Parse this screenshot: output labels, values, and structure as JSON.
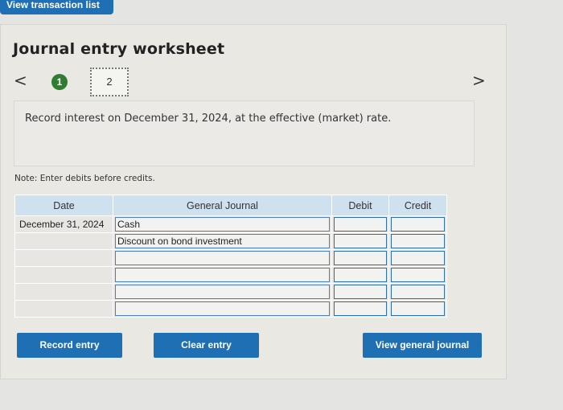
{
  "header": {
    "view_transactions_label": "View transaction list"
  },
  "worksheet": {
    "title": "Journal entry worksheet",
    "nav": {
      "prev_glyph": "<",
      "next_glyph": ">"
    },
    "steps": [
      "1",
      "2"
    ],
    "prompt": "Record interest on December 31, 2024, at the effective (market) rate.",
    "note": "Note: Enter debits before credits."
  },
  "table": {
    "headers": {
      "date": "Date",
      "general_journal": "General Journal",
      "debit": "Debit",
      "credit": "Credit"
    },
    "rows": [
      {
        "date": "December 31, 2024",
        "account": "Cash",
        "debit": "",
        "credit": ""
      },
      {
        "date": "",
        "account": "Discount on bond investment",
        "debit": "",
        "credit": ""
      },
      {
        "date": "",
        "account": "",
        "debit": "",
        "credit": ""
      },
      {
        "date": "",
        "account": "",
        "debit": "",
        "credit": ""
      },
      {
        "date": "",
        "account": "",
        "debit": "",
        "credit": ""
      },
      {
        "date": "",
        "account": "",
        "debit": "",
        "credit": ""
      }
    ]
  },
  "buttons": {
    "record": "Record entry",
    "clear": "Clear entry",
    "view_general_journal": "View general journal"
  },
  "colors": {
    "primary": "#1f6fb4",
    "step_complete": "#2e7d32",
    "table_header": "#cfe0ef"
  }
}
